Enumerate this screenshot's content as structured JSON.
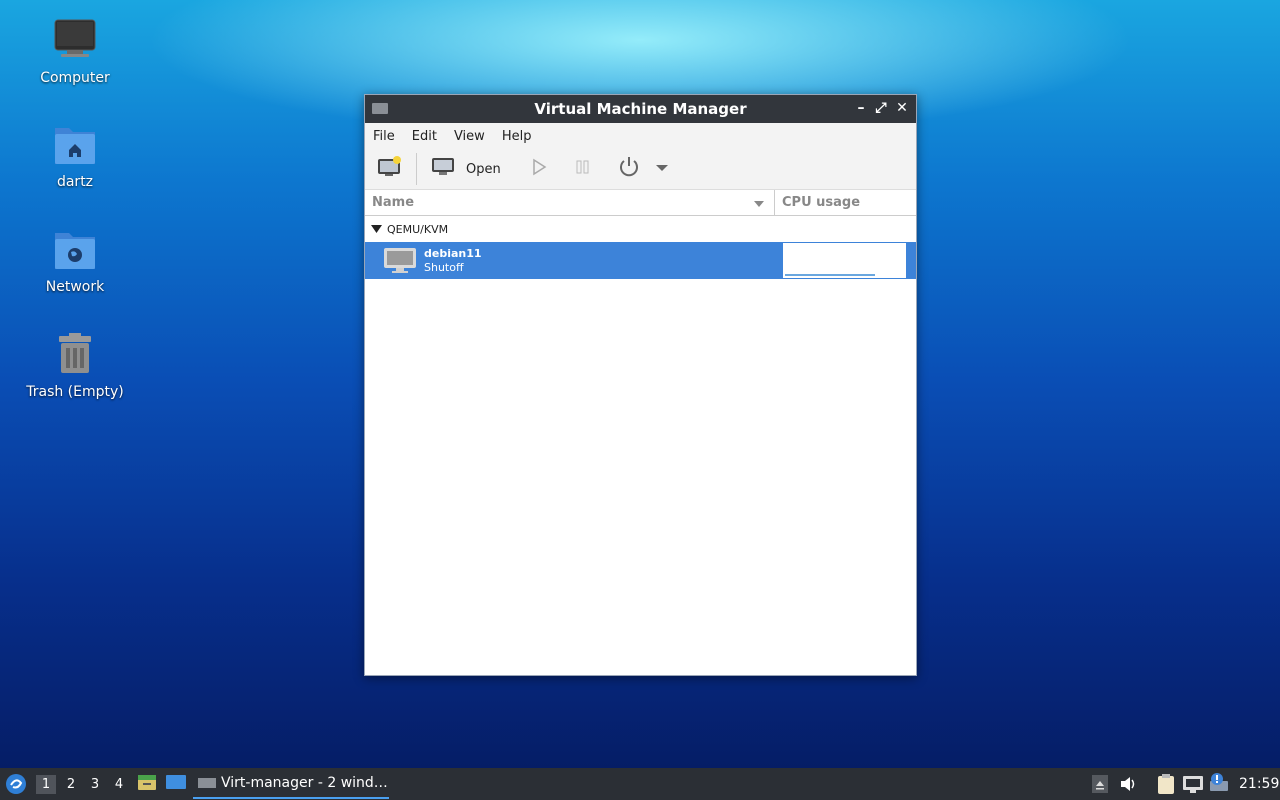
{
  "desktop": {
    "icons": [
      {
        "label": "Computer",
        "icon": "computer-icon"
      },
      {
        "label": "dartz",
        "icon": "home-folder-icon"
      },
      {
        "label": "Network",
        "icon": "network-folder-icon"
      },
      {
        "label": "Trash (Empty)",
        "icon": "trash-icon"
      }
    ]
  },
  "window": {
    "title": "Virtual Machine Manager",
    "menu": [
      "File",
      "Edit",
      "View",
      "Help"
    ],
    "toolbar": {
      "new_vm_icon": "new-vm-icon",
      "open_label": "Open",
      "run_icon": "play-icon",
      "pause_icon": "pause-icon",
      "power_icon": "power-icon",
      "dropdown_icon": "chevron-down-icon"
    },
    "columns": {
      "name": "Name",
      "cpu": "CPU usage"
    },
    "group": {
      "label": "QEMU/KVM"
    },
    "vm": {
      "name": "debian11",
      "status": "Shutoff"
    }
  },
  "taskbar": {
    "workspaces": [
      "1",
      "2",
      "3",
      "4"
    ],
    "active_workspace": "1",
    "task_label": "Virt-manager - 2 wind…",
    "clock": "21:59"
  },
  "colors": {
    "selection": "#3d83d9",
    "titlebar": "#32363c",
    "taskbar": "#2b2f35"
  }
}
